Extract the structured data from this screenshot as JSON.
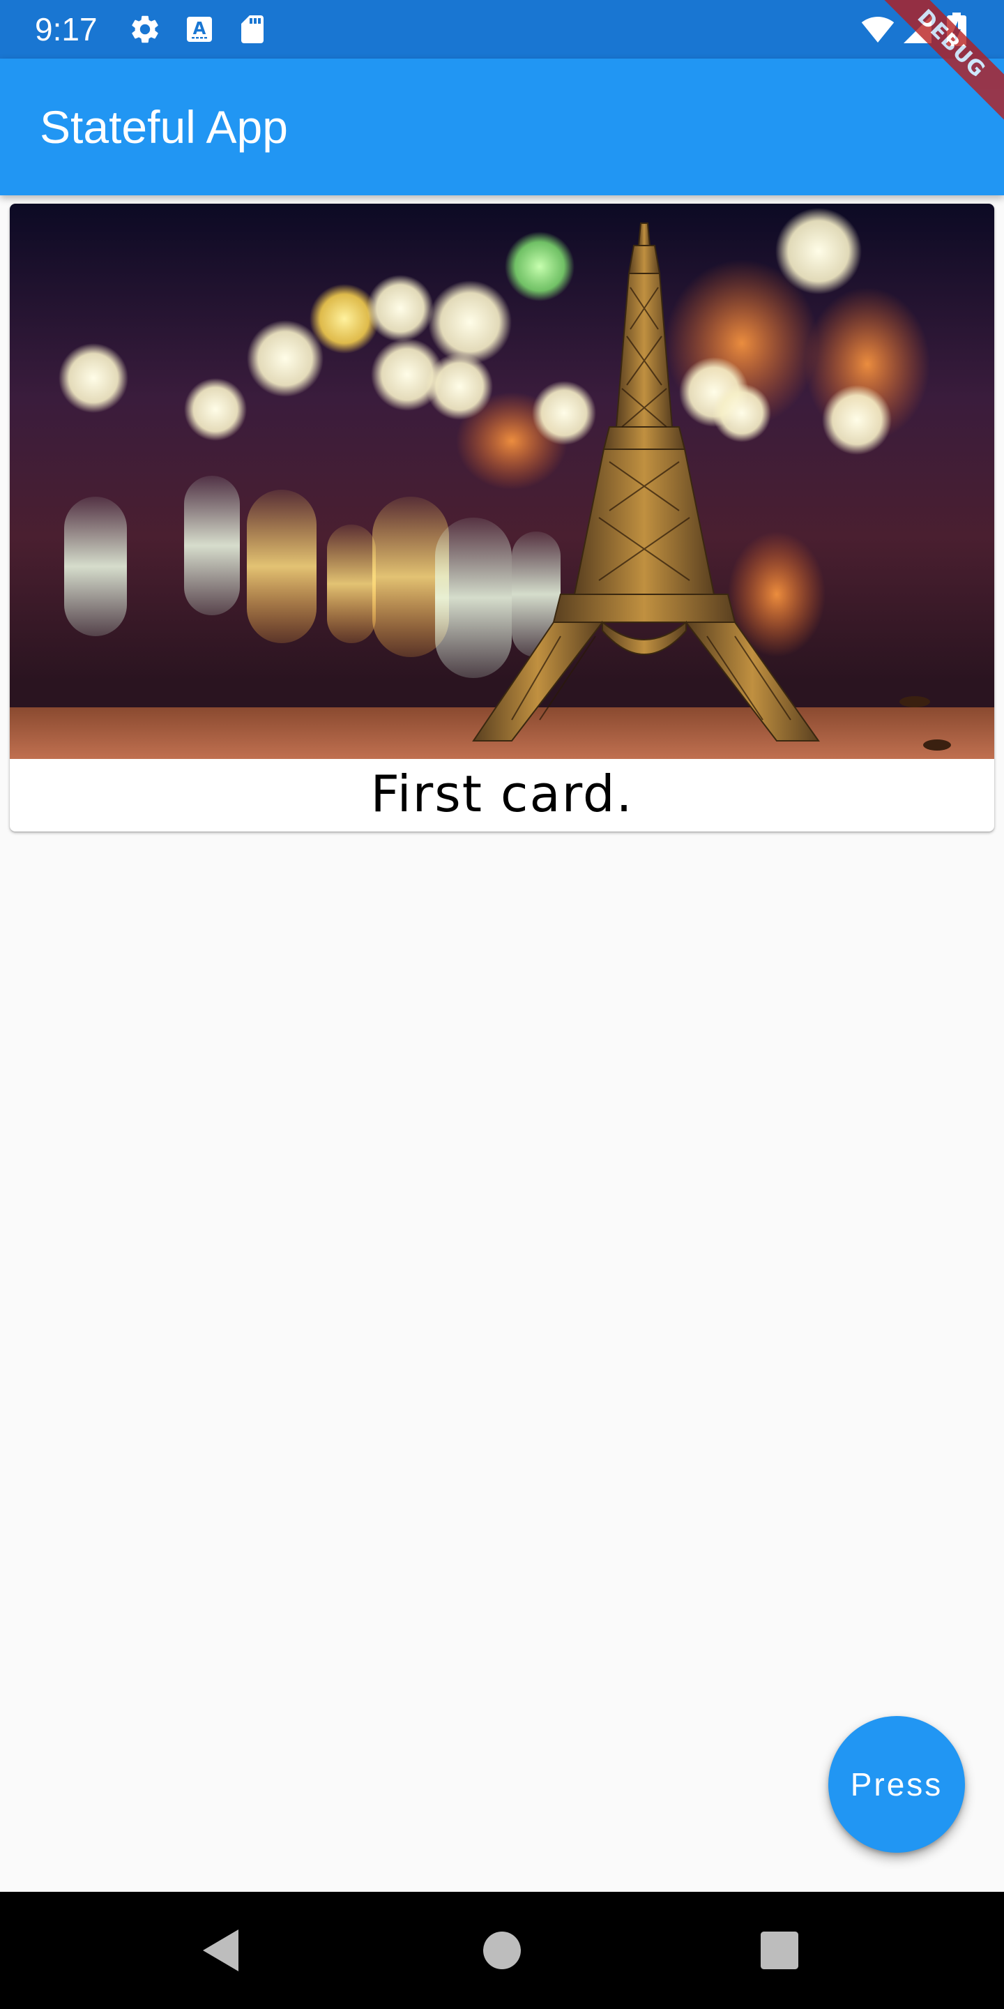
{
  "status_bar": {
    "time": "9:17",
    "left_icons": [
      "gear-icon",
      "a-keyboard-icon",
      "sd-card-icon"
    ],
    "right_icons": [
      "wifi-icon",
      "signal-icon",
      "battery-charging-icon"
    ]
  },
  "debug_banner": {
    "label": "DEBUG"
  },
  "app_bar": {
    "title": "Stateful App"
  },
  "card": {
    "image_icon": "eiffel-tower-bokeh-photo",
    "caption": "First card."
  },
  "fab": {
    "label": "Press"
  },
  "nav_bar": {
    "icons": [
      "back-triangle-icon",
      "home-circle-icon",
      "recents-square-icon"
    ]
  },
  "colors": {
    "status_bar": "#1976d2",
    "app_bar": "#2196f3",
    "fab": "#2196f3",
    "background": "#fafafa",
    "debug_banner": "#b71c1c"
  }
}
